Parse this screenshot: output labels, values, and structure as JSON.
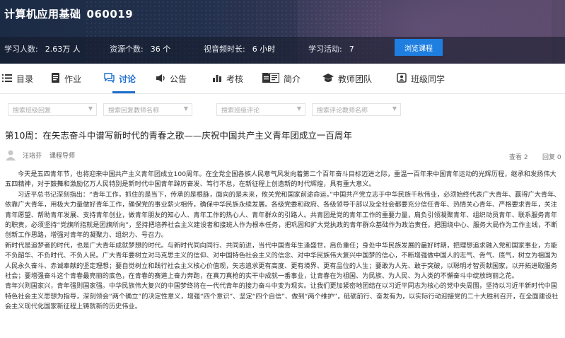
{
  "course": {
    "title": "计算机应用基础",
    "code": "060019"
  },
  "stats": [
    {
      "label": "学习人数:",
      "value": "2.63万 人"
    },
    {
      "label": "资源个数:",
      "value": "36 个"
    },
    {
      "label": "视音频时长:",
      "value": "6 小时"
    },
    {
      "label": "学习活动:",
      "value": "7"
    }
  ],
  "browse_button": "浏览课程",
  "tabs": [
    {
      "label": "目录",
      "icon": "list-icon"
    },
    {
      "label": "作业",
      "icon": "homework-icon"
    },
    {
      "label": "讨论",
      "icon": "discussion-icon"
    },
    {
      "label": "公告",
      "icon": "announcement-icon"
    },
    {
      "label": "考核",
      "icon": "assessment-icon"
    },
    {
      "label": "",
      "icon": "document-icon"
    },
    {
      "label": "简介",
      "icon": "intro-icon"
    },
    {
      "label": "教师团队",
      "icon": "teachers-icon"
    },
    {
      "label": "班级同学",
      "icon": "classmates-icon"
    }
  ],
  "active_tab": "讨论",
  "filters": [
    {
      "placeholder": "搜索班级回复"
    },
    {
      "placeholder": "搜索回复教师名称"
    },
    {
      "placeholder": "搜索班级评论"
    },
    {
      "placeholder": "搜索评论教师名称"
    }
  ],
  "topic": {
    "title": "第10周：在矢志奋斗中谱写新时代的青春之歌——庆祝中国共产主义青年团成立一百周年",
    "author": "汪培芬",
    "role": "课程导师",
    "views": "查看 2",
    "replies": "回复 0",
    "paragraphs": [
      "今天是五四青年节，也将迎来中国共产主义青年团成立100周年。在全党全国各族人民意气风发向着第二个百年奋斗目标迈进之际，重温一百年来中国青年运动的光辉历程，继承和发扬伟大五四精神，对于鼓舞和激励亿万人民特别是新时代中国青年踔厉奋发、笃行不怠，在新征程上创造新的时代辉煌，具有重大意义。",
      "习近平总书记深刻指出：“青年工作，抓住的是当下，传承的是根脉，面向的是未来，攸关党和国家前途命运。”中国共产党立志于中华民族千秋伟业，必须始终代表广大青年、赢得广大青年、依靠广大青年，用极大力量做好青年工作，确保党的事业薪火相传，确保中华民族永续发展。各级党委和政府、各级领导干部以及全社会都要充分信任青年、热情关心青年、严格要求青年，关注青年愿望、帮助青年发展、支持青年创业，做青年朋友的知心人、青年工作的热心人、青年群众的引路人。共青团是党的青年工作的重要力量，肩负引领凝聚青年、组织动员青年、联系服务青年的职责，必须坚持“党旗所指就是团旗所向”，坚持把培养社会主义建设者和接班人作为根本任务，把巩固和扩大党执政的青年群众基础作为政治责任，把围绕中心、服务大局作为工作主线，不断创新工作思路，增强对青年的凝聚力、组织力、号召力。",
      "新时代是追梦者的时代，也是广大青年成就梦想的时代。与新时代同向同行、共同前进，当代中国青年生逢盛世，肩负重任；身处中华民族发展的最好时期，把理想追求融入党和国家事业，方能不负韶华、不负时代、不负人民。广大青年要树立对马克思主义的信仰、对中国特色社会主义的信念、对中华民族伟大复兴中国梦的信心，不断增强做中国人的志气、骨气、底气，树立为祖国为人民永久奋斗、赤诚奉献的坚定理想；要自觉树立和践行社会主义核心价值观，矢志追求更有高度、更有境界、更有品位的人生；要敢为人先、敢于突破，以聪明才智贡献国家，以开拓进取服务社会；要增强奋斗这个青春最亮丽的底色，在青春的赛道上奋力奔跑，在真刀真枪的实干中成就一番事业，让青春在为祖国、为民族、为人民、为人类的不懈奋斗中绽放绚丽之花。",
      "青年兴则国家兴，青年强则国家强。中华民族伟大复兴的中国梦终将在一代代青年的接力奋斗中变为现实。让我们更加紧密地团结在以习近平同志为核心的党中央周围，坚持以习近平新时代中国特色社会主义思想为指导，深刻领会“两个确立”的决定性意义，增强“四个意识”、坚定“四个自信”、做到“两个维护”，砥砺前行、奋发有为，以实际行动迎接党的二十大胜利召开，在全面建设社会主义现代化国家新征程上铸就新的历史伟业。"
    ]
  },
  "colors": {
    "accent": "#1e6fd0",
    "button": "#1e7fe0",
    "banner_dark": "#1c2b45"
  }
}
